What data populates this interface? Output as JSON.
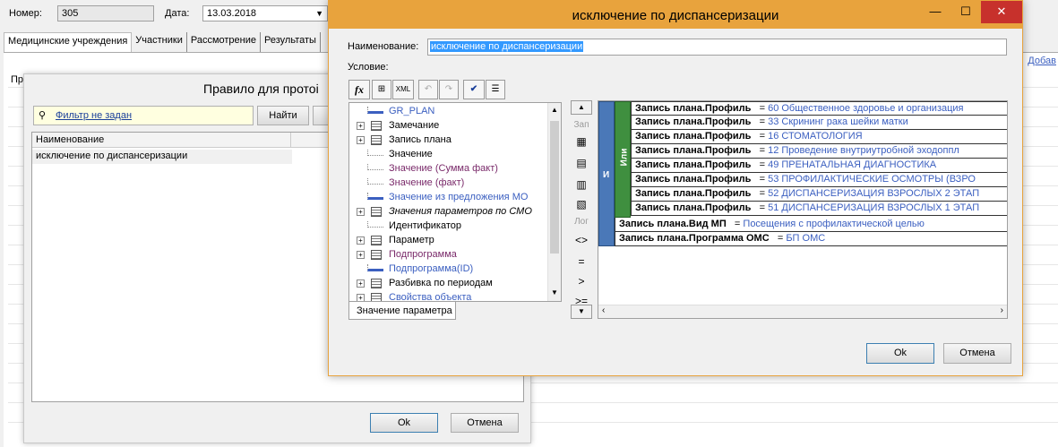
{
  "main_app": {
    "number_label": "Номер:",
    "number_value": "305",
    "date_label": "Дата:",
    "date_value": "13.03.2018",
    "tabs": [
      "Медицинские учреждения",
      "Участники",
      "Рассмотрение",
      "Результаты"
    ],
    "add_link": "Добав",
    "col_header_partial": "Пр"
  },
  "rule_dialog": {
    "title": "Правило для протоі",
    "filter_label": "Фильтр не задан",
    "find_button": "Найти",
    "column_name": "Наименование",
    "row1": "исключение по диспансеризации",
    "ok": "Ok",
    "cancel": "Отмена"
  },
  "dialog": {
    "title": "исключение по диспансеризации",
    "name_label": "Наименование:",
    "name_value": "исключение по диспансеризации",
    "condition_label": "Условие:",
    "toolbar": [
      "fx",
      "xml-icon",
      "undo-icon",
      "redo-icon",
      "check-icon",
      "list-icon"
    ],
    "xml_label": "XML",
    "tree": [
      {
        "label": "GR_PLAN",
        "style": "blue",
        "expand": false,
        "icon": "field"
      },
      {
        "label": "Замечание",
        "style": "black",
        "expand": true,
        "icon": "table"
      },
      {
        "label": "Запись плана",
        "style": "black",
        "expand": true,
        "icon": "table"
      },
      {
        "label": "Значение",
        "style": "black",
        "expand": false,
        "icon": "dots"
      },
      {
        "label": "Значение (Сумма факт)",
        "style": "purple",
        "expand": false,
        "icon": "dots"
      },
      {
        "label": "Значение (факт)",
        "style": "purple",
        "expand": false,
        "icon": "dots"
      },
      {
        "label": "Значение из предложения МО",
        "style": "blue",
        "expand": false,
        "icon": "field"
      },
      {
        "label": "Значения параметров по СМО",
        "style": "italic",
        "expand": true,
        "icon": "table"
      },
      {
        "label": "Идентификатор",
        "style": "black",
        "expand": false,
        "icon": "dots"
      },
      {
        "label": "Параметр",
        "style": "black",
        "expand": true,
        "icon": "table"
      },
      {
        "label": "Подпрограмма",
        "style": "purple",
        "expand": true,
        "icon": "table"
      },
      {
        "label": "Подпрограмма(ID)",
        "style": "blue",
        "expand": false,
        "icon": "field"
      },
      {
        "label": "Разбивка по периодам",
        "style": "black",
        "expand": true,
        "icon": "table"
      },
      {
        "label": "Свойства объекта",
        "style": "blue",
        "expand": true,
        "icon": "table"
      }
    ],
    "tree_tab": "Значение параметра",
    "op_labels": {
      "zap": "Зап",
      "log": "Лог"
    },
    "operators": [
      "<>",
      "=",
      ">",
      ">="
    ],
    "and_label": "И",
    "or_label": "Или",
    "or_conditions": [
      {
        "field": "Запись плана.Профиль",
        "op": "=",
        "value": "60 Общественное здоровье и организация"
      },
      {
        "field": "Запись плана.Профиль",
        "op": "=",
        "value": "33 Скрининг рака шейки матки"
      },
      {
        "field": "Запись плана.Профиль",
        "op": "=",
        "value": "16 СТОМАТОЛОГИЯ"
      },
      {
        "field": "Запись плана.Профиль",
        "op": "=",
        "value": "12 Проведение внутриутробной эходоппл"
      },
      {
        "field": "Запись плана.Профиль",
        "op": "=",
        "value": "49 ПРЕНАТАЛЬНАЯ ДИАГНОСТИКА"
      },
      {
        "field": "Запись плана.Профиль",
        "op": "=",
        "value": "53 ПРОФИЛАКТИЧЕСКИЕ ОСМОТРЫ (ВЗРО"
      },
      {
        "field": "Запись плана.Профиль",
        "op": "=",
        "value": "52 ДИСПАНСЕРИЗАЦИЯ ВЗРОСЛЫХ 2 ЭТАП"
      },
      {
        "field": "Запись плана.Профиль",
        "op": "=",
        "value": "51 ДИСПАНСЕРИЗАЦИЯ ВЗРОСЛЫХ 1 ЭТАП"
      }
    ],
    "and_conditions": [
      {
        "field": "Запись плана.Вид МП",
        "op": "=",
        "value": "Посещения с профилактической целью"
      },
      {
        "field": "Запись плана.Программа ОМС",
        "op": "=",
        "value": "БП ОМС"
      }
    ],
    "ok": "Ok",
    "cancel": "Отмена"
  },
  "colors": {
    "title_bar": "#e8a33d",
    "and_block": "#4a78b8",
    "or_block": "#3f8f3f",
    "close_btn": "#c7312c"
  }
}
